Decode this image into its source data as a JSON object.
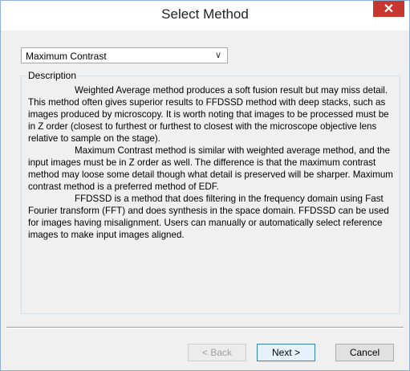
{
  "window": {
    "title": "Select Method",
    "close_glyph": "✕"
  },
  "method_select": {
    "value": "Maximum Contrast",
    "chevron": "∨"
  },
  "description": {
    "label": "Description",
    "paragraphs": [
      "Weighted Average method produces a soft fusion result but may miss detail. This method often gives superior results to FFDSSD method with deep stacks, such as images produced by microscopy. It is worth noting that images to be processed must be in Z order (closest to furthest or furthest to closest with the microscope objective lens relative to sample on the stage).",
      "Maximum Contrast method is similar with weighted average method, and the input images must be in Z order as well. The difference is that the maximum contrast method may loose some detail though what detail is preserved will be sharper. Maximum contrast method is a preferred method of EDF.",
      "FFDSSD is a method that does filtering in the frequency domain using Fast Fourier transform (FFT) and does synthesis in the space domain. FFDSSD can be used for images having misalignment. Users can manually or automatically select reference images to make input images aligned."
    ]
  },
  "buttons": {
    "back": "< Back",
    "next": "Next >",
    "cancel": "Cancel"
  },
  "colors": {
    "close_button": "#c7372f",
    "dialog_background": "#f0f0f0",
    "default_button_border": "#3c7fb1"
  }
}
